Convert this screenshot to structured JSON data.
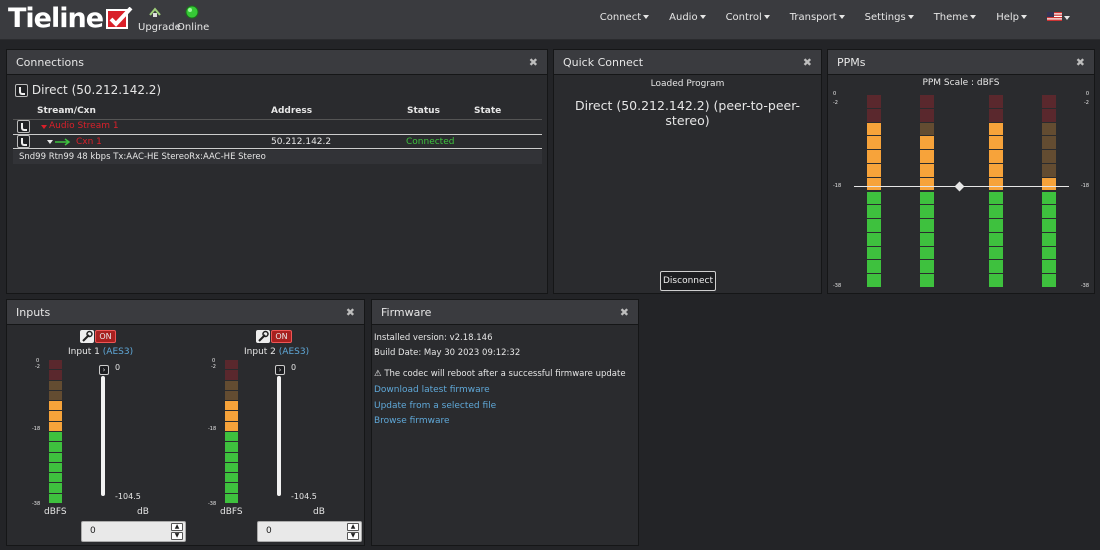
{
  "brand": {
    "name": "Tieline",
    "accent": "#d9202a"
  },
  "topbar": {
    "upgrade": "Upgrade",
    "online": "Online",
    "menu": [
      "Connect",
      "Audio",
      "Control",
      "Transport",
      "Settings",
      "Theme",
      "Help"
    ]
  },
  "connections": {
    "title": "Connections",
    "program": "Direct (50.212.142.2)",
    "columns": [
      "Stream/Cxn",
      "Address",
      "Status",
      "State"
    ],
    "stream": "Audio Stream 1",
    "cxn": {
      "name": "Cxn 1",
      "address": "50.212.142.2",
      "status": "Connected",
      "state": ""
    },
    "details": "Snd99 Rtn99 48 kbps Tx:AAC-HE StereoRx:AAC-HE Stereo"
  },
  "quick": {
    "title": "Quick Connect",
    "loaded": "Loaded Program",
    "program": "Direct (50.212.142.2) (peer-to-peer-stereo)",
    "disconnect": "Disconnect"
  },
  "ppms": {
    "title": "PPMs",
    "scale": "PPM Scale : dBFS",
    "ticks": [
      "0",
      "-2",
      "-18",
      "-38"
    ],
    "levels": [
      0.86,
      0.82,
      0.88,
      0.6
    ]
  },
  "inputs": {
    "title": "Inputs",
    "channels": [
      {
        "on": "ON",
        "label": "Input 1",
        "source": "(AES3)",
        "fader_max": "0",
        "fader_min": "-104.5",
        "units_l": "dBFS",
        "units_r": "dB",
        "value": "0",
        "level": 0.78,
        "ticks": [
          "0",
          "-2",
          "-18",
          "-38"
        ]
      },
      {
        "on": "ON",
        "label": "Input 2",
        "source": "(AES3)",
        "fader_max": "0",
        "fader_min": "-104.5",
        "units_l": "dBFS",
        "units_r": "dB",
        "value": "0",
        "level": 0.76,
        "ticks": [
          "0",
          "-2",
          "-18",
          "-38"
        ]
      }
    ]
  },
  "firmware": {
    "title": "Firmware",
    "installed": "Installed version: v2.18.146",
    "build": "Build Date: May 30 2023 09:12:32",
    "warning": "The codec will reboot after a successful firmware update",
    "links": [
      "Download latest firmware",
      "Update from a selected file",
      "Browse firmware"
    ]
  },
  "colors": {
    "green": "#3ec13e",
    "amber": "#f7a33a",
    "red": "#d9202a",
    "link": "#5fa8d8"
  }
}
